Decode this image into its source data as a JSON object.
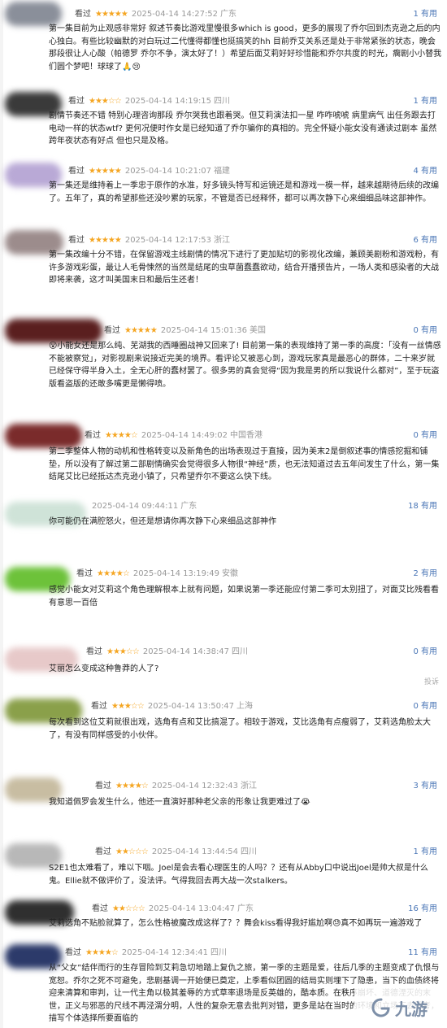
{
  "reviews": [
    {
      "user_action": "看过",
      "stars": "★★★★★",
      "date": "2025-04-14 14:27:52",
      "location": "广东",
      "useful": "1 有用",
      "text": "第一集目前为止观感非常好 叙述节奏比游戏里慢很多which is good，更多的展现了乔尔回到杰克逊之后的内心独白。有些比较幽默的对白玩过二代懂得都懂也挺搞笑的hh 目前乔艾关系还是处于非常紧张的状态，晚会那段很让人心酸（帕德罗 乔尔不争，演太好了！）希望后面艾莉好好珍惜能和乔尔共度的时光，瘸剧小小替我们圆个梦吧！球球了🙏😢",
      "avatar_color": "#8a8f9a"
    },
    {
      "user_action": "看过",
      "stars": "★★★☆☆",
      "date": "2025-04-14 14:19:15",
      "location": "四川",
      "useful": "1 有用",
      "text": "剧情节奏还不错 特别心理咨询那段 乔尔哭我也跟着哭。但艾莉演法扣一星 咋咋唬唬 病里病气 出任务跟去打电动一样的状态wtf? 更何况便时作女是已经知道了乔尔骗你的真相的。完全怀疑小能女没有通读过剧本 虽然跨年夜状态有好点 但也只是及格。",
      "avatar_color": "#3a3a3a"
    },
    {
      "user_action": "看过",
      "stars": "★★★★★",
      "date": "2025-04-14 10:21:07",
      "location": "福建",
      "useful": "4 有用",
      "text": "第一集还是维持着上一季忠于原作的水准，好多镜头特写和运镜还是和游戏一模一样，越来越期待后续的改编了。五年了，真的希望那些还没吵累的玩家，不管是否已经释怀，都可以再次静下心来细细品味这部神作。",
      "avatar_color": "#b9a9d6"
    },
    {
      "user_action": "看过",
      "stars": "★★★★★",
      "date": "2025-04-14 12:17:53",
      "location": "浙江",
      "useful": "6 有用",
      "text": "第一集改编十分不错，在保留游戏主线剧情的情况下进行了更加贴切的影视化改编，兼顾美剧粉和游戏粉，有许多游戏彩蛋，最让人毛骨悚然的当然是结尾的虫草菌蠢蠢欲动，结合开播预告片，一场人类和感染者的大战即将来袭，这才叫美国末日和最后生还者！",
      "avatar_color": "#9c8c8c"
    },
    {
      "user_action": "看过",
      "stars": "★★★★★",
      "date": "2025-04-14 15:01:36",
      "location": "美国",
      "useful": "0 有用",
      "text": "😮小能女还是那么纯、芜湖我的西睡圈战神又回来了! 目前第一集的表现维持了第一季的高度：「没有一丝情感不能被察觉」，对影视剧来说接近完美的境界。看评论又被恶心到，游戏玩家真是最恶心的群体，二十来岁就已经保守得半身入土，全无心肝的蠢材罢了。很多男的真会觉得“因为我是男的所以我说什么都对”，至于玩盗版看盗版的还敢多嘴更是懒得喷。",
      "avatar_color": "#5a1f1f"
    },
    {
      "user_action": "看过",
      "stars": "★★★★☆",
      "date": "2025-04-14 14:49:02",
      "location": "中国香港",
      "useful": "0 有用",
      "text": "第二季整体人物的动机和性格转变以及新角色的出场表现过于直接，因为美末2是倒叙述事的情感挖掘和铺垫，所以没有了解过第二部剧情确实会觉得很多人物很“神经”质，也无法知道过去五年间发生了什么，第一集结尾艾比已经抵达杰克逊小镇了，只希望乔尔不要这么快下线。",
      "avatar_color": "#7a2b2b"
    },
    {
      "user_action": "",
      "stars": "",
      "date": "2025-04-14 09:44:11",
      "location": "广东",
      "useful": "18 有用",
      "text": "你可能仍在满腔怒火，但还是想请你再次静下心来细品这部神作",
      "avatar_color": "#cfe3d8"
    },
    {
      "user_action": "看过",
      "stars": "★★★★☆",
      "date": "2025-04-14 13:19:49",
      "location": "安徽",
      "useful": "2 有用",
      "text": "感觉小能女对艾莉这个角色理解根本上就有问题，如果说第一季还能应付第二季可太别扭了，对面艾比残看看有意思一百倍",
      "avatar_color": "#6dc23a"
    },
    {
      "user_action": "看过",
      "stars": "★★★☆☆",
      "date": "2025-04-14 14:38:47",
      "location": "四川",
      "useful": "0 有用",
      "text": "艾丽怎么变成这种鲁莽的人了?",
      "report": "投诉",
      "avatar_color": "#e7c9c9"
    },
    {
      "user_action": "看过",
      "stars": "★★★☆☆",
      "date": "2025-04-14 13:50:47",
      "location": "上海",
      "useful": "0 有用",
      "text": "每次看到这位艾莉就很出戏，选角有点和艾比搞混了。相较于游戏，艾比选角有点瘦弱了，艾莉选角脸太大了，有没有同样感受的小伙伴。",
      "avatar_color": "#8aa04a"
    },
    {
      "user_action": "看过",
      "stars": "★★★★☆",
      "date": "2025-04-14 12:32:43",
      "location": "浙江",
      "useful": "3 有用",
      "text": "我知道佩罗会发生什么，他还一直演好那种老父亲的形象让我更难过了😭",
      "avatar_color": "#c8bda2"
    },
    {
      "user_action": "看过",
      "stars": "★★☆☆☆",
      "date": "2025-04-14 13:44:54",
      "location": "四川",
      "useful": "1 有用",
      "text": "S2E1也太难看了，难以下咽。Joel是会去看心理医生的人吗？？还有从Abby口中说出Joel是帅大叔是什么鬼。Ellie就不做评价了，没法评。气得我回去再大战一次stalkers。",
      "avatar_color": "#b8b8b8"
    },
    {
      "user_action": "看过",
      "stars": "★★☆☆☆",
      "date": "2025-04-14 13:04:47",
      "location": "广东",
      "useful": "16 有用",
      "text": "艾莉选角不贴脸就算了，怎么性格被魔改成这样了？？舞会kiss看得我好尴尬啊😓真不如再玩一遍游戏了",
      "avatar_color": "#2f2f2f"
    },
    {
      "user_action": "看过",
      "stars": "★★★★☆",
      "date": "2025-04-14 12:34:41",
      "location": "四川",
      "useful": "11 有用",
      "text": "从“父女”结伴而行的生存冒险到艾莉急切地踏上复仇之旅，第一季的主题是爱，往后几季的主题变成了仇恨与宽恕。乔尔之死不可避免，悲剧基调一开始便已奠定，上季看似团圆的结局实则埋下了隐患，当下的血债终将迎来清算和审判，让一代主角以极其羞辱的方式草率退场是反英雄的，酷本质。在秩序崩坏、道德湮灭的末世，正义与邪恶的尺线不再泾渭分明，人性的复杂无意去批判对错，更多是站在当时的环境和立场下去思考，描写个体选择所要面临的",
      "avatar_color": "#2c3a6a"
    }
  ],
  "watermark": {
    "text": "九游"
  }
}
